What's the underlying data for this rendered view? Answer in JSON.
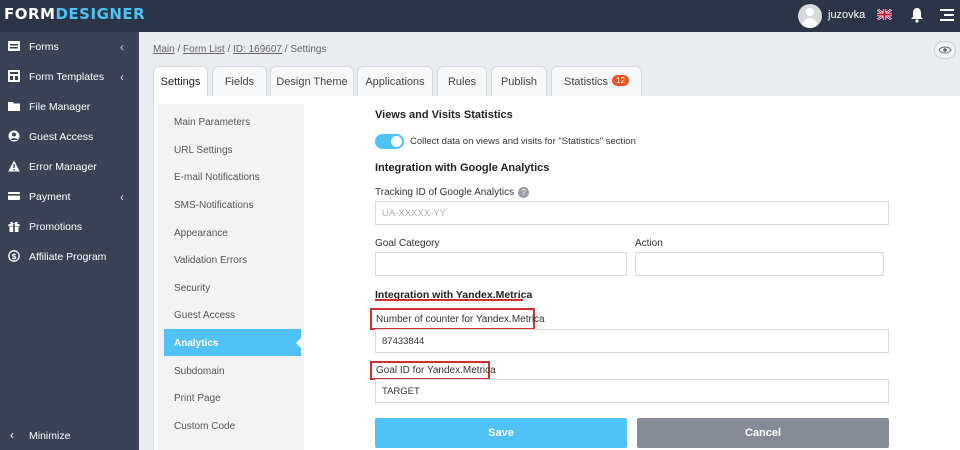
{
  "header": {
    "logo_part1": "FORM",
    "logo_part2": "DESIGNER",
    "username": "juzovka",
    "icons": [
      "avatar-icon",
      "uk-flag-icon",
      "bell-icon",
      "menu-icon"
    ]
  },
  "sidebar": {
    "items": [
      {
        "label": "Forms",
        "icon": "forms-icon",
        "has_submenu": true
      },
      {
        "label": "Form Templates",
        "icon": "templates-icon",
        "has_submenu": true
      },
      {
        "label": "File Manager",
        "icon": "folder-icon",
        "has_submenu": false
      },
      {
        "label": "Guest Access",
        "icon": "user-circle-icon",
        "has_submenu": false
      },
      {
        "label": "Error Manager",
        "icon": "warning-icon",
        "has_submenu": false
      },
      {
        "label": "Payment",
        "icon": "card-icon",
        "has_submenu": true
      },
      {
        "label": "Promotions",
        "icon": "gift-icon",
        "has_submenu": false
      },
      {
        "label": "Affiliate Program",
        "icon": "dollar-icon",
        "has_submenu": false
      }
    ],
    "minimize_label": "Minimize"
  },
  "breadcrumb": {
    "main": "Main",
    "form_list": "Form List",
    "id": "ID: 169607",
    "current": "Settings",
    "sep": " / "
  },
  "tabs": [
    {
      "label": "Settings",
      "active": true
    },
    {
      "label": "Fields",
      "active": false
    },
    {
      "label": "Design Theme",
      "active": false
    },
    {
      "label": "Applications",
      "active": false
    },
    {
      "label": "Rules",
      "active": false
    },
    {
      "label": "Publish",
      "active": false
    },
    {
      "label": "Statistics",
      "active": false,
      "badge": "12"
    }
  ],
  "subnav": [
    {
      "label": "Main Parameters",
      "active": false
    },
    {
      "label": "URL Settings",
      "active": false
    },
    {
      "label": "E-mail Notifications",
      "active": false
    },
    {
      "label": "SMS-Notifications",
      "active": false
    },
    {
      "label": "Appearance",
      "active": false
    },
    {
      "label": "Validation Errors",
      "active": false
    },
    {
      "label": "Security",
      "active": false
    },
    {
      "label": "Guest Access",
      "active": false
    },
    {
      "label": "Analytics",
      "active": true
    },
    {
      "label": "Subdomain",
      "active": false
    },
    {
      "label": "Print Page",
      "active": false
    },
    {
      "label": "Custom Code",
      "active": false
    }
  ],
  "analytics": {
    "views_title": "Views and Visits Statistics",
    "collect_toggle": {
      "on": true,
      "label": "Collect data on views and visits for \"Statistics\" section"
    },
    "ga_title": "Integration with Google Analytics",
    "ga_tracking_label": "Tracking ID of Google Analytics",
    "ga_tracking_help": "?",
    "ga_tracking_placeholder": "UA-XXXXX-YY",
    "ga_tracking_value": "",
    "goal_category_label": "Goal Category",
    "goal_category_value": "",
    "action_label": "Action",
    "action_value": "",
    "ym_title": "Integration with Yandex.Metrica",
    "ym_counter_label": "Number of counter for Yandex.Metrica",
    "ym_counter_value": "87433844",
    "ym_goal_label": "Goal ID for Yandex.Metrica",
    "ym_goal_value": "TARGET"
  },
  "buttons": {
    "save": "Save",
    "cancel": "Cancel"
  },
  "colors": {
    "topbar": "#2c3547",
    "sidebar": "#3a4256",
    "accent": "#4fc3f7",
    "highlight_red": "#d32f2f",
    "badge": "#f4511e",
    "cancel": "#858c97"
  }
}
